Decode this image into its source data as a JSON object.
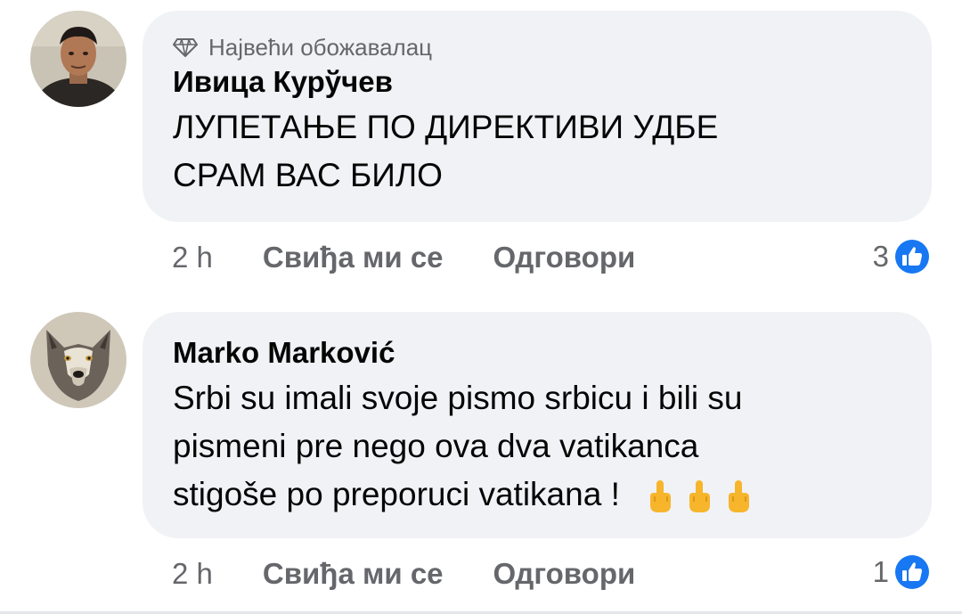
{
  "comments": [
    {
      "badge": "Највећи обожавалац",
      "badge_icon": "diamond-icon",
      "author": "Ивица Курўчев",
      "text_lines": [
        "ЛУПЕТАЊЕ ПО ДИРЕКТИВИ УДБЕ",
        "СРАМ ВАС БИЛО"
      ],
      "time": "2 h",
      "like_label": "Свиђа ми се",
      "reply_label": "Одговори",
      "reaction_count": "3",
      "reaction_icon": "like-icon"
    },
    {
      "author": "Marko Marković",
      "text_lines": [
        "Srbi su imali svoje pismo srbicu i bili su",
        "pismeni pre nego ova dva vatikanca",
        "stigoše po preporuci vatikana !"
      ],
      "emojis": [
        "middle-finger-emoji",
        "middle-finger-emoji",
        "middle-finger-emoji"
      ],
      "time": "2 h",
      "like_label": "Свиђа ми се",
      "reply_label": "Одговори",
      "reaction_count": "1",
      "reaction_icon": "like-icon"
    }
  ],
  "colors": {
    "bubble": "#f0f2f5",
    "secondary_text": "#65676b",
    "primary_text": "#050505",
    "like_blue": "#1877f2"
  }
}
